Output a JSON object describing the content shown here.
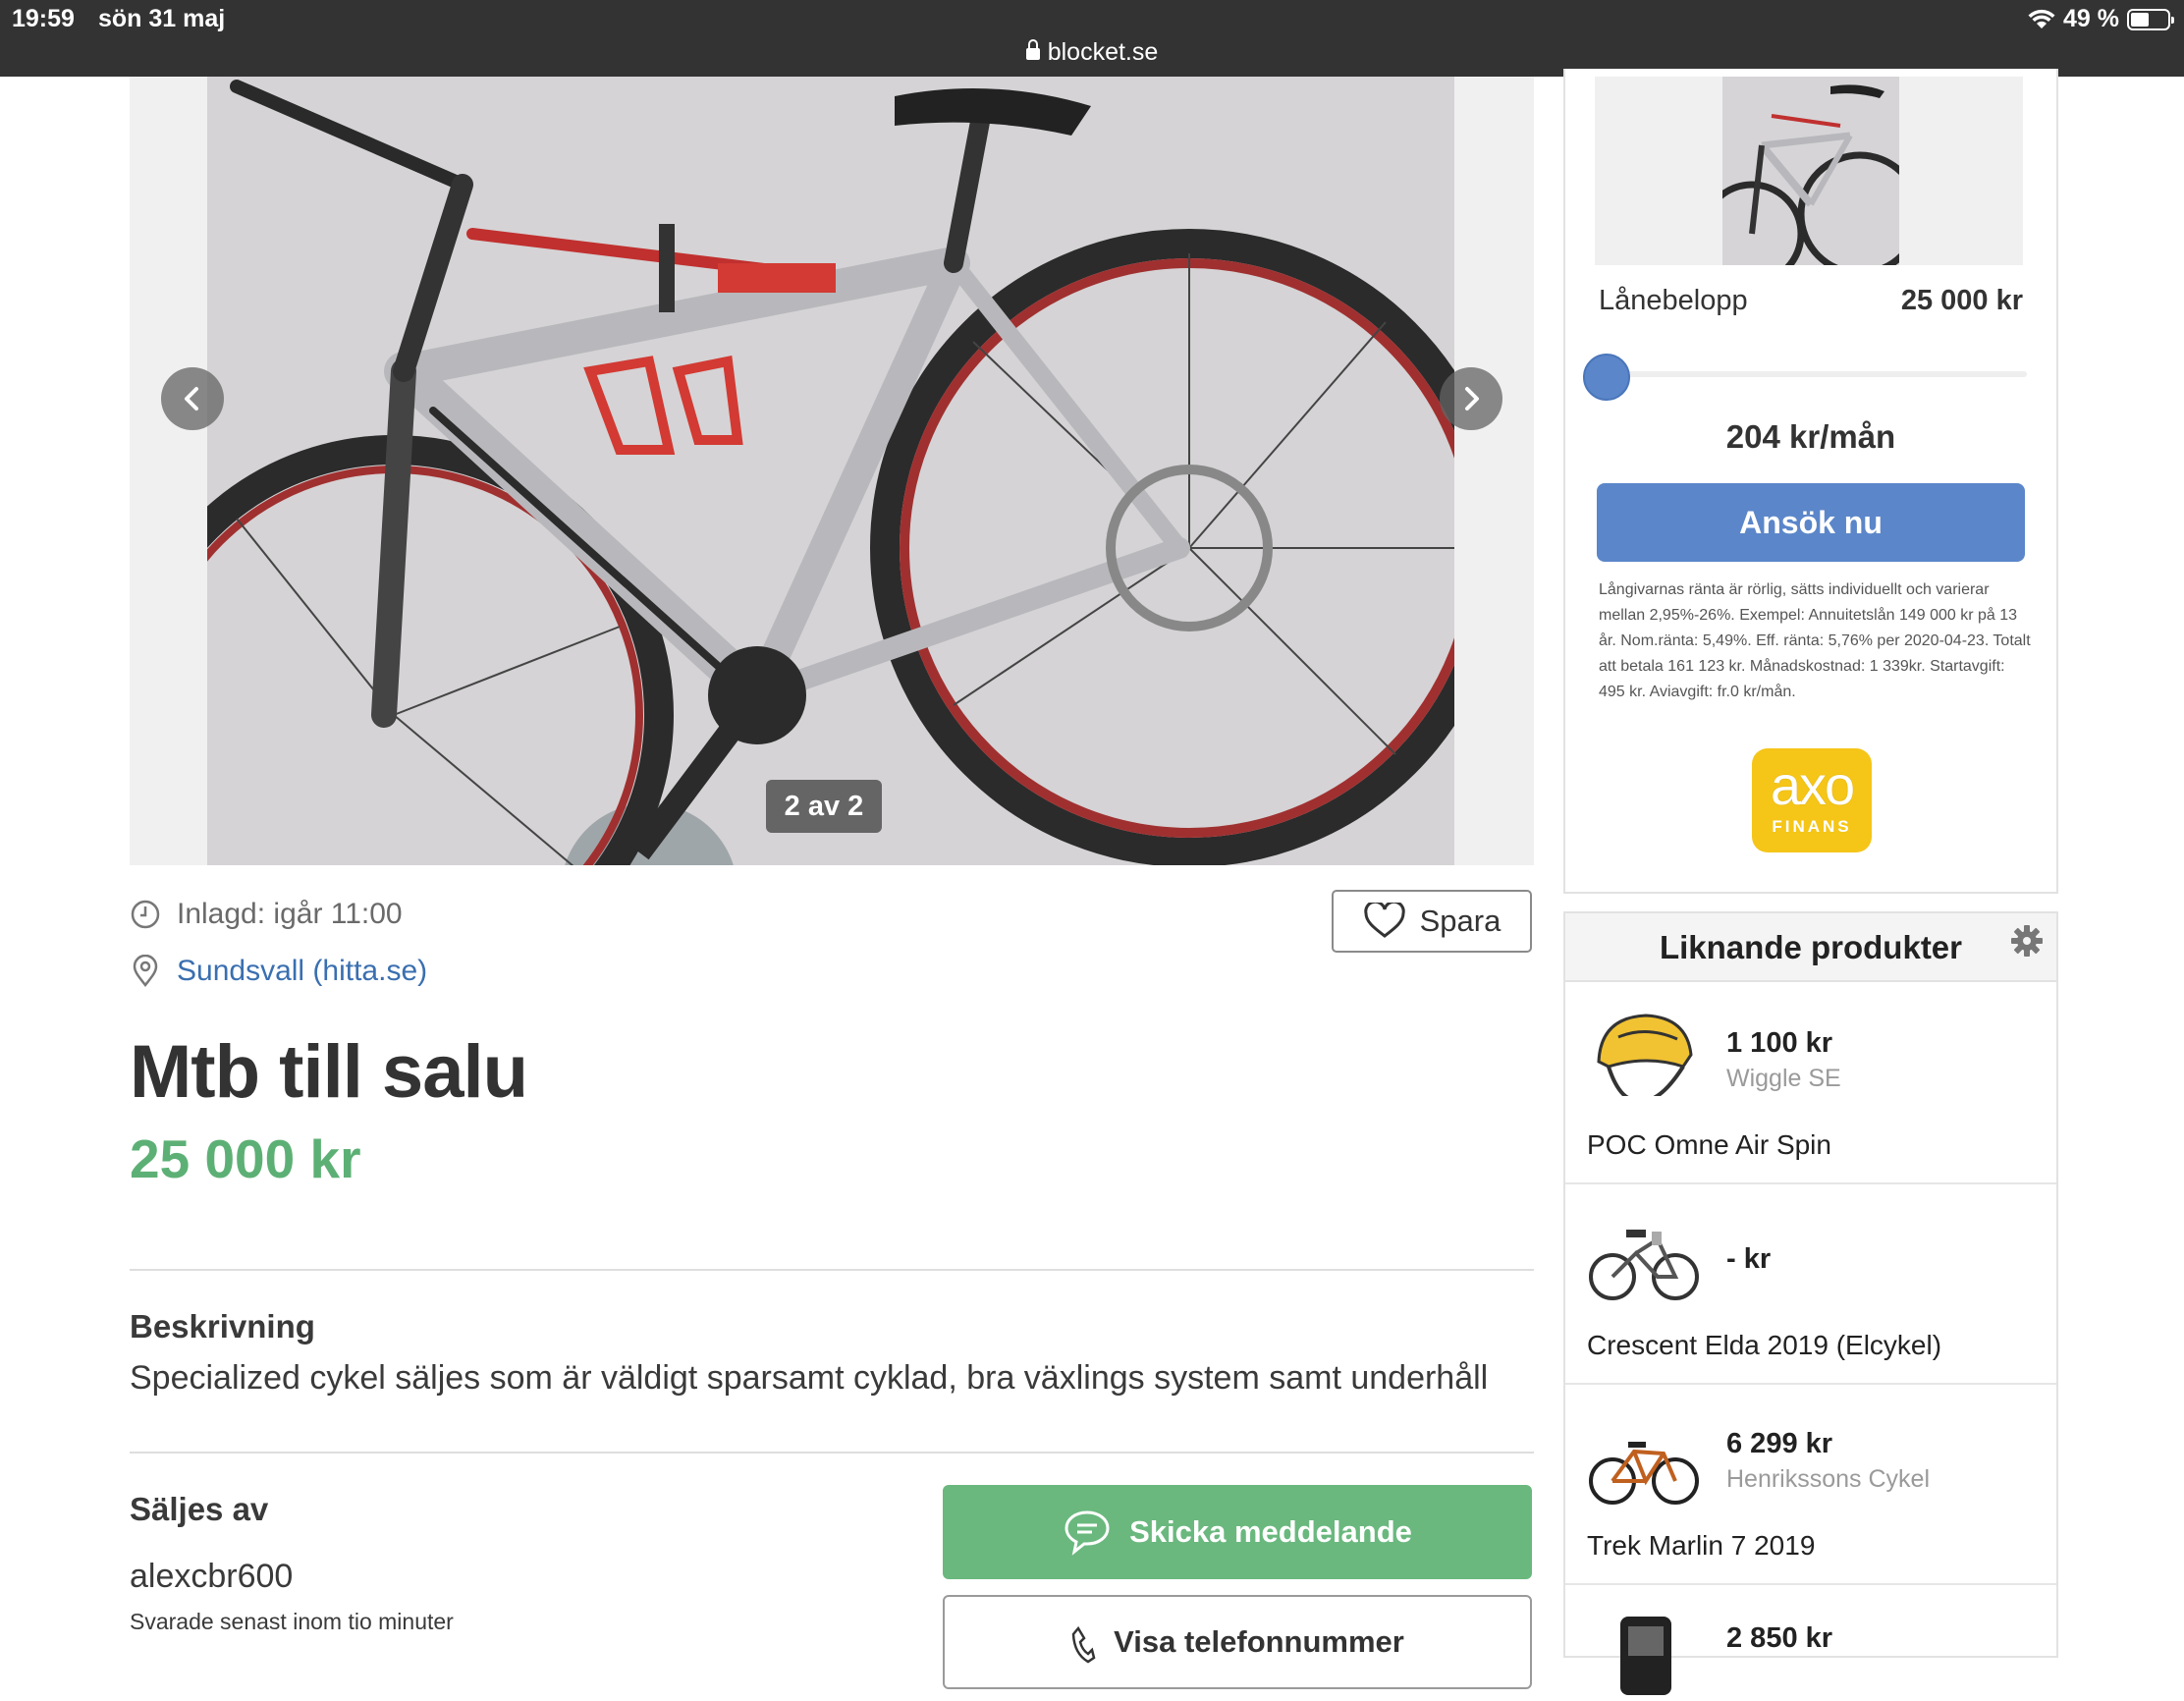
{
  "status_bar": {
    "time": "19:59",
    "date": "sön 31 maj",
    "url": "blocket.se",
    "battery": "49 %",
    "battery_level": 0.49
  },
  "gallery": {
    "counter": "2 av 2",
    "prev_icon": "chevron-left-icon",
    "next_icon": "chevron-right-icon"
  },
  "listing": {
    "posted": "Inlagd: igår 11:00",
    "location": "Sundsvall (hitta.se)",
    "save_label": "Spara",
    "title": "Mtb till salu",
    "price": "25 000 kr",
    "description_heading": "Beskrivning",
    "description": "Specialized cykel säljes som är väldigt sparsamt cyklad, bra växlings system samt underhåll",
    "seller_heading": "Säljes av",
    "seller_name": "alexcbr600",
    "seller_response": "Svarade senast inom tio minuter",
    "message_button": "Skicka meddelande",
    "phone_button": "Visa telefonnummer"
  },
  "loan": {
    "label": "Lånebelopp",
    "amount": "25 000 kr",
    "slider_fraction": 0.0,
    "monthly": "204 kr/mån",
    "apply_label": "Ansök nu",
    "fine_print": "Långivarnas ränta är rörlig, sätts individuellt och varierar mellan 2,95%-26%. Exempel: Annuitetslån 149 000 kr på 13 år. Nom.ränta: 5,49%. Eff. ränta: 5,76% per 2020-04-23. Totalt att betala 161 123 kr. Månadskostnad: 1 339kr. Startavgift: 495 kr. Aviavgift: fr.0 kr/mån.",
    "logo_text": "axo",
    "logo_subtext": "FINANS",
    "accent_color": "#5b86c9",
    "logo_color": "#f5c518"
  },
  "similar": {
    "heading": "Liknande produkter",
    "products": [
      {
        "price": "1 100 kr",
        "shop": "Wiggle SE",
        "name": "POC Omne Air Spin",
        "icon": "helmet-icon"
      },
      {
        "price": "- kr",
        "shop": "",
        "name": "Crescent Elda 2019 (Elcykel)",
        "icon": "ebike-icon"
      },
      {
        "price": "6 299 kr",
        "shop": "Henrikssons Cykel",
        "name": "Trek Marlin 7 2019",
        "icon": "bike-icon"
      },
      {
        "price": "2 850 kr",
        "shop": "",
        "name": "",
        "icon": "device-icon"
      }
    ]
  },
  "colors": {
    "price_green": "#5db075",
    "link_blue": "#3a6fb0",
    "message_green": "#6ab87e"
  }
}
